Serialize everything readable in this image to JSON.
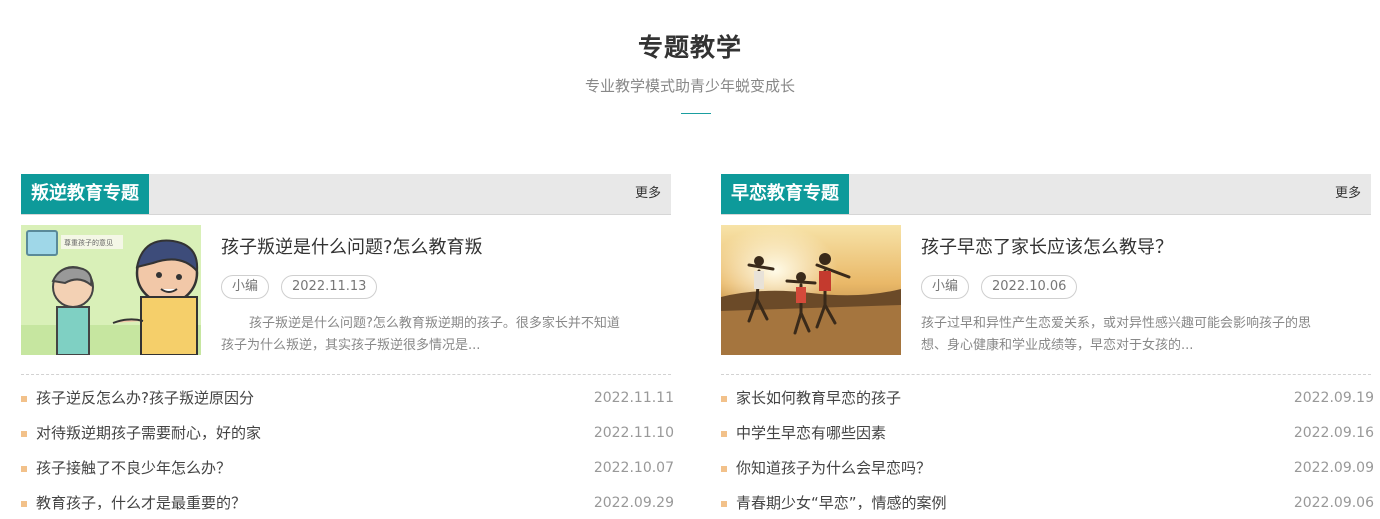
{
  "header": {
    "title": "专题教学",
    "subtitle": "专业教学模式助青少年蜕变成长",
    "accent_color": "#1a9ea0"
  },
  "columns": [
    {
      "tab_label": "叛逆教育专题",
      "more_label": "更多",
      "tab_color": "#0e9a9a",
      "featured": {
        "image": "cartoon-parent-child",
        "image_caption": "尊重孩子的意见",
        "title": "孩子叛逆是什么问题?怎么教育叛",
        "author": "小编",
        "date": "2022.11.13",
        "desc": "孩子叛逆是什么问题?怎么教育叛逆期的孩子。很多家长并不知道孩子为什么叛逆，其实孩子叛逆很多情况是..."
      },
      "items": [
        {
          "text": "孩子逆反怎么办?孩子叛逆原因分",
          "date": "2022.11.11"
        },
        {
          "text": "对待叛逆期孩子需要耐心，好的家",
          "date": "2022.11.10"
        },
        {
          "text": "孩子接触了不良少年怎么办？",
          "date": "2022.10.07"
        },
        {
          "text": "教育孩子，什么才是最重要的？",
          "date": "2022.09.29"
        }
      ]
    },
    {
      "tab_label": "早恋教育专题",
      "more_label": "更多",
      "tab_color": "#0e9a9a",
      "featured": {
        "image": "family-running-sunset-photo",
        "title": "孩子早恋了家长应该怎么教导？",
        "author": "小编",
        "date": "2022.10.06",
        "desc": "孩子过早和异性产生恋爱关系，或对异性感兴趣可能会影响孩子的思想、身心健康和学业成绩等，早恋对于女孩的..."
      },
      "items": [
        {
          "text": "家长如何教育早恋的孩子",
          "date": "2022.09.19"
        },
        {
          "text": "中学生早恋有哪些因素",
          "date": "2022.09.16"
        },
        {
          "text": "你知道孩子为什么会早恋吗？",
          "date": "2022.09.09"
        },
        {
          "text": "青春期少女“早恋”，情感的案例",
          "date": "2022.09.06"
        }
      ]
    }
  ]
}
